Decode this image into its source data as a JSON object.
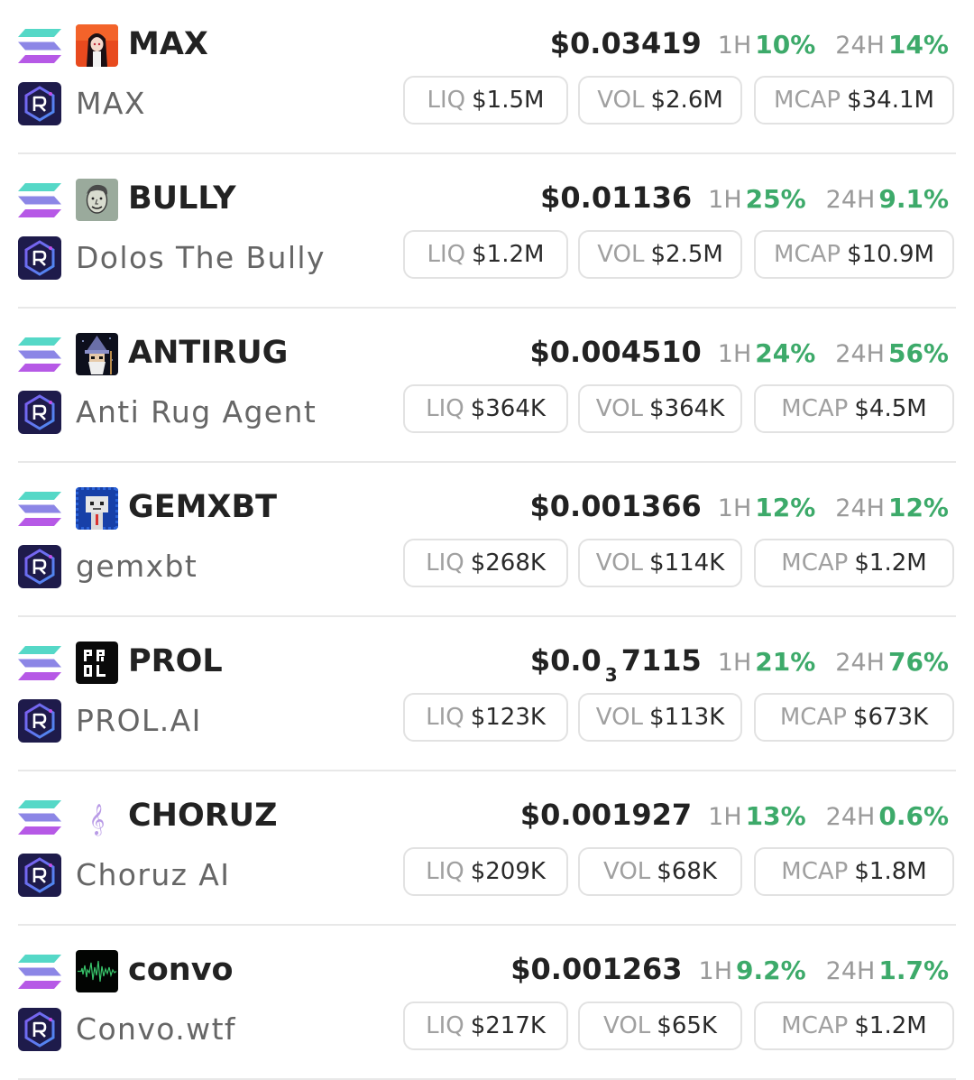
{
  "colors": {
    "positive": "#3daa6a",
    "text_primary": "#222222",
    "text_secondary": "#666666",
    "label_grey": "#a0a0a0",
    "pill_border": "#e2e2e2"
  },
  "labels": {
    "h1": "1H",
    "h24": "24H",
    "liq": "LIQ",
    "vol": "VOL",
    "mcap": "MCAP"
  },
  "tokens": [
    {
      "symbol": "MAX",
      "name": "MAX",
      "price": "$0.03419",
      "change_1h": "10%",
      "change_24h": "14%",
      "liq": "$1.5M",
      "vol": "$2.6M",
      "mcap": "$34.1M",
      "chain_icon": "solana-icon",
      "dex_icon": "raydium-icon",
      "avatar_icon": "anime-girl-avatar-icon"
    },
    {
      "symbol": "BULLY",
      "name": "Dolos The Bully",
      "price": "$0.01136",
      "change_1h": "25%",
      "change_24h": "9.1%",
      "liq": "$1.2M",
      "vol": "$2.5M",
      "mcap": "$10.9M",
      "chain_icon": "solana-icon",
      "dex_icon": "raydium-icon",
      "avatar_icon": "sketch-face-avatar-icon"
    },
    {
      "symbol": "ANTIRUG",
      "name": "Anti Rug Agent",
      "price": "$0.004510",
      "change_1h": "24%",
      "change_24h": "56%",
      "liq": "$364K",
      "vol": "$364K",
      "mcap": "$4.5M",
      "chain_icon": "solana-icon",
      "dex_icon": "raydium-icon",
      "avatar_icon": "wizard-avatar-icon"
    },
    {
      "symbol": "GEMXBT",
      "name": "gemxbt",
      "price": "$0.001366",
      "change_1h": "12%",
      "change_24h": "12%",
      "liq": "$268K",
      "vol": "$114K",
      "mcap": "$1.2M",
      "chain_icon": "solana-icon",
      "dex_icon": "raydium-icon",
      "avatar_icon": "pixel-robot-avatar-icon"
    },
    {
      "symbol": "PROL",
      "name": "PROL.AI",
      "price_prefix": "$0.0",
      "price_subscript": "3",
      "price_suffix": "7115",
      "change_1h": "21%",
      "change_24h": "76%",
      "liq": "$123K",
      "vol": "$113K",
      "mcap": "$673K",
      "chain_icon": "solana-icon",
      "dex_icon": "raydium-icon",
      "avatar_icon": "prol-logo-avatar-icon"
    },
    {
      "symbol": "CHORUZ",
      "name": "Choruz AI",
      "price": "$0.001927",
      "change_1h": "13%",
      "change_24h": "0.6%",
      "liq": "$209K",
      "vol": "$68K",
      "mcap": "$1.8M",
      "chain_icon": "solana-icon",
      "dex_icon": "raydium-icon",
      "avatar_icon": "treble-clef-avatar-icon"
    },
    {
      "symbol": "convo",
      "name": "Convo.wtf",
      "price": "$0.001263",
      "change_1h": "9.2%",
      "change_24h": "1.7%",
      "liq": "$217K",
      "vol": "$65K",
      "mcap": "$1.2M",
      "chain_icon": "solana-icon",
      "dex_icon": "raydium-icon",
      "avatar_icon": "waveform-avatar-icon"
    }
  ]
}
